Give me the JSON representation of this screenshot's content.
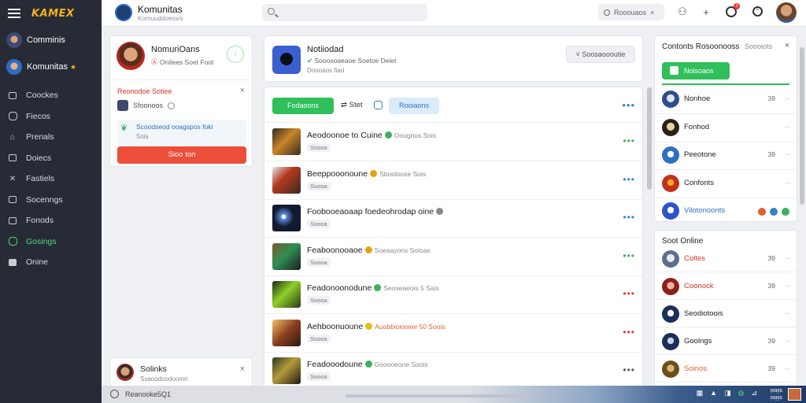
{
  "sidebar": {
    "brand": "KAMEX",
    "users": [
      {
        "name": "Comminis",
        "star": ""
      },
      {
        "name": "Komunitas",
        "star": "★"
      }
    ],
    "items": [
      {
        "label": "Coockes"
      },
      {
        "label": "Fiecos"
      },
      {
        "label": "Prenals"
      },
      {
        "label": "Doiecs"
      },
      {
        "label": "Fastiels"
      },
      {
        "label": "Socenngs"
      },
      {
        "label": "Fonods"
      },
      {
        "label": "Gosings",
        "active": true
      },
      {
        "label": "Onine"
      }
    ]
  },
  "header": {
    "title": "Komunitas",
    "subtitle": "Komuuddoessrs",
    "mini_search": "Rooouaos",
    "mini_search_chevron": "×",
    "notif_count": "1"
  },
  "profile": {
    "name": "NomuriOans",
    "status_prefix": "Ⓐ",
    "status": "Onitees Soet Foot",
    "action": "⁝",
    "alert_title": "Reonodoe Sotiee",
    "alert_close": "×",
    "alert_text": "Sfoonoos",
    "tip_title": "Scoodseod ooagspos foki",
    "tip_sub": "Sois",
    "button": "Sioo ton"
  },
  "bottom_profile": {
    "name": "Solinks",
    "sub": "Ssaoodoodoomn",
    "close": "×"
  },
  "bottombar": {
    "text": "Reanooke5Q1",
    "time_top": "ᴉᴉoᴉᴉᴉs",
    "time_bottom": "ᴉoᴉᴉᴉᴉs"
  },
  "channel": {
    "name": "Notiiodad",
    "meta_prefix": "✔",
    "meta": "Sooosoaeaoe Soetoe Deiet",
    "meta2": "Doooaos fiad",
    "button": "Soosaoooutie",
    "button_chevron": "˅"
  },
  "feed": {
    "toolbar": {
      "green": "Fodaoons",
      "sort": "Stet",
      "sort_icon": "⇄",
      "blue": "Rooiaons",
      "more": "•••"
    },
    "posts": [
      {
        "title": "Aeodoonoe to Cuine",
        "meta": "Oougnus Sois",
        "badge": "Soooa",
        "dots_color": "#3fae5f",
        "icon_color": "#3fae5f"
      },
      {
        "title": "Beeppooonoune",
        "meta": "Sbooloose Sois",
        "badge": "Soooa",
        "dots_color": "#2f86c9",
        "icon_color": "#e2a313"
      },
      {
        "title": "Foobooeaoaap foedeohrodap oine",
        "meta": "",
        "badge": "Soooa",
        "dots_color": "#2f86c9",
        "icon_color": "#888"
      },
      {
        "title": "Feaboonooaoe",
        "meta": "Soeaayons Soioas",
        "badge": "Soooa",
        "dots_color": "#3fae5f",
        "icon_color": "#e2a313"
      },
      {
        "title": "Feadonoonodune",
        "meta": "Seoseaeois 5 Sais",
        "badge": "Soooa",
        "dots_color": "#e53935",
        "icon_color": "#3fae5f"
      },
      {
        "title": "Aehboonuoune",
        "meta": "Auobbioiooiee 50 Soois",
        "badge": "Soooa",
        "dots_color": "#e53935",
        "icon_color": "#e2c313",
        "meta_color": "#e0612c"
      },
      {
        "title": "Feadooodoune",
        "meta": "Gooooeone Soois",
        "badge": "Soooa",
        "dots_color": "#555",
        "icon_color": "#3fae5f"
      }
    ]
  },
  "friends": {
    "title": "Contonts Rosoonooss",
    "subtitle": "Soooiots",
    "close": "×",
    "button": "Noisoaos",
    "list": [
      {
        "name": "Nonhoe",
        "count": "39",
        "dots": "··",
        "blue": false
      },
      {
        "name": "Fonhod",
        "count": "",
        "dots": "··",
        "blue": false
      },
      {
        "name": "Peeotone",
        "count": "39",
        "dots": "··",
        "blue": false
      },
      {
        "name": "Confonts",
        "count": "",
        "dots": "··",
        "blue": false
      },
      {
        "name": "Vilotonoonts",
        "count": "",
        "dots": "",
        "blue": true
      }
    ]
  },
  "online": {
    "title": "Soot Online",
    "list": [
      {
        "name": "Coltes",
        "count": "39",
        "dots": "··",
        "color": "#d93025"
      },
      {
        "name": "Coonock",
        "count": "39",
        "dots": "··",
        "color": "#d93025"
      },
      {
        "name": "Seodiotoois",
        "count": "",
        "dots": "··",
        "color": "#222"
      },
      {
        "name": "Goolngs",
        "count": "39",
        "dots": "··",
        "color": "#222"
      },
      {
        "name": "Soinos",
        "count": "39",
        "dots": "··",
        "color": "#e0612c"
      }
    ]
  }
}
